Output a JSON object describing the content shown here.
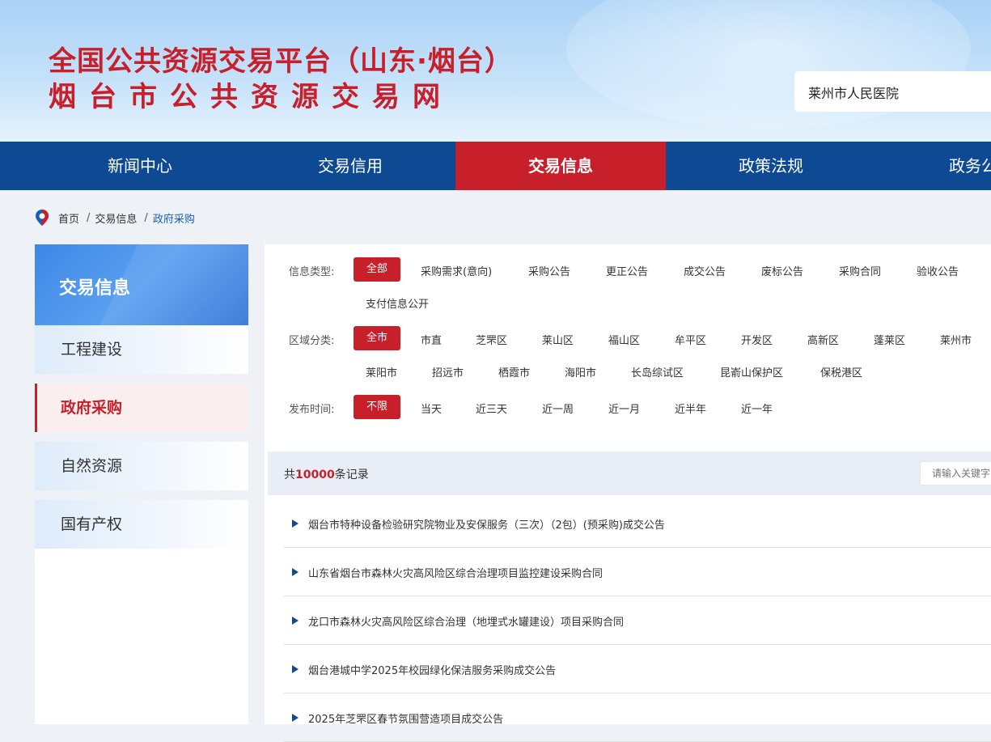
{
  "header": {
    "title_line1": "全国公共资源交易平台（山东·烟台）",
    "title_line2": "烟台市公共资源交易网",
    "search_value": "莱州市人民医院"
  },
  "nav": [
    "新闻中心",
    "交易信用",
    "交易信息",
    "政策法规",
    "政务公开"
  ],
  "nav_active": "交易信息",
  "breadcrumb": {
    "home": "首页",
    "level1": "交易信息",
    "current": "政府采购"
  },
  "sidebar": {
    "title": "交易信息",
    "items": [
      "工程建设",
      "政府采购",
      "自然资源",
      "国有产权"
    ],
    "active": "政府采购"
  },
  "filters": {
    "type_label": "信息类型:",
    "type_options": [
      "全部",
      "采购需求(意向)",
      "采购公告",
      "更正公告",
      "成交公告",
      "废标公告",
      "采购合同",
      "验收公告",
      "支付信息公开"
    ],
    "region_label": "区域分类:",
    "region_options": [
      "全市",
      "市直",
      "芝罘区",
      "莱山区",
      "福山区",
      "牟平区",
      "开发区",
      "高新区",
      "蓬莱区",
      "莱州市",
      "莱阳市",
      "招远市",
      "栖霞市",
      "海阳市",
      "长岛综试区",
      "昆嵛山保护区",
      "保税港区"
    ],
    "time_label": "发布时间:",
    "time_options": [
      "不限",
      "当天",
      "近三天",
      "近一周",
      "近一月",
      "近半年",
      "近一年"
    ]
  },
  "records": {
    "prefix": "共",
    "count": "10000",
    "suffix": "条记录",
    "keyword_placeholder": "请输入关键字"
  },
  "list": [
    "烟台市特种设备检验研究院物业及安保服务（三次）（2包）(预采购)成交公告",
    "山东省烟台市森林火灾高风险区综合治理项目监控建设采购合同",
    "龙口市森林火灾高风险区综合治理（地埋式水罐建设）项目采购合同",
    "烟台港城中学2025年校园绿化保洁服务采购成交公告",
    "2025年芝罘区春节氛围营造项目成交公告"
  ],
  "colors": {
    "brand_red": "#c8202a",
    "nav_blue": "#0e4a94",
    "link_blue": "#1a5fb4"
  }
}
